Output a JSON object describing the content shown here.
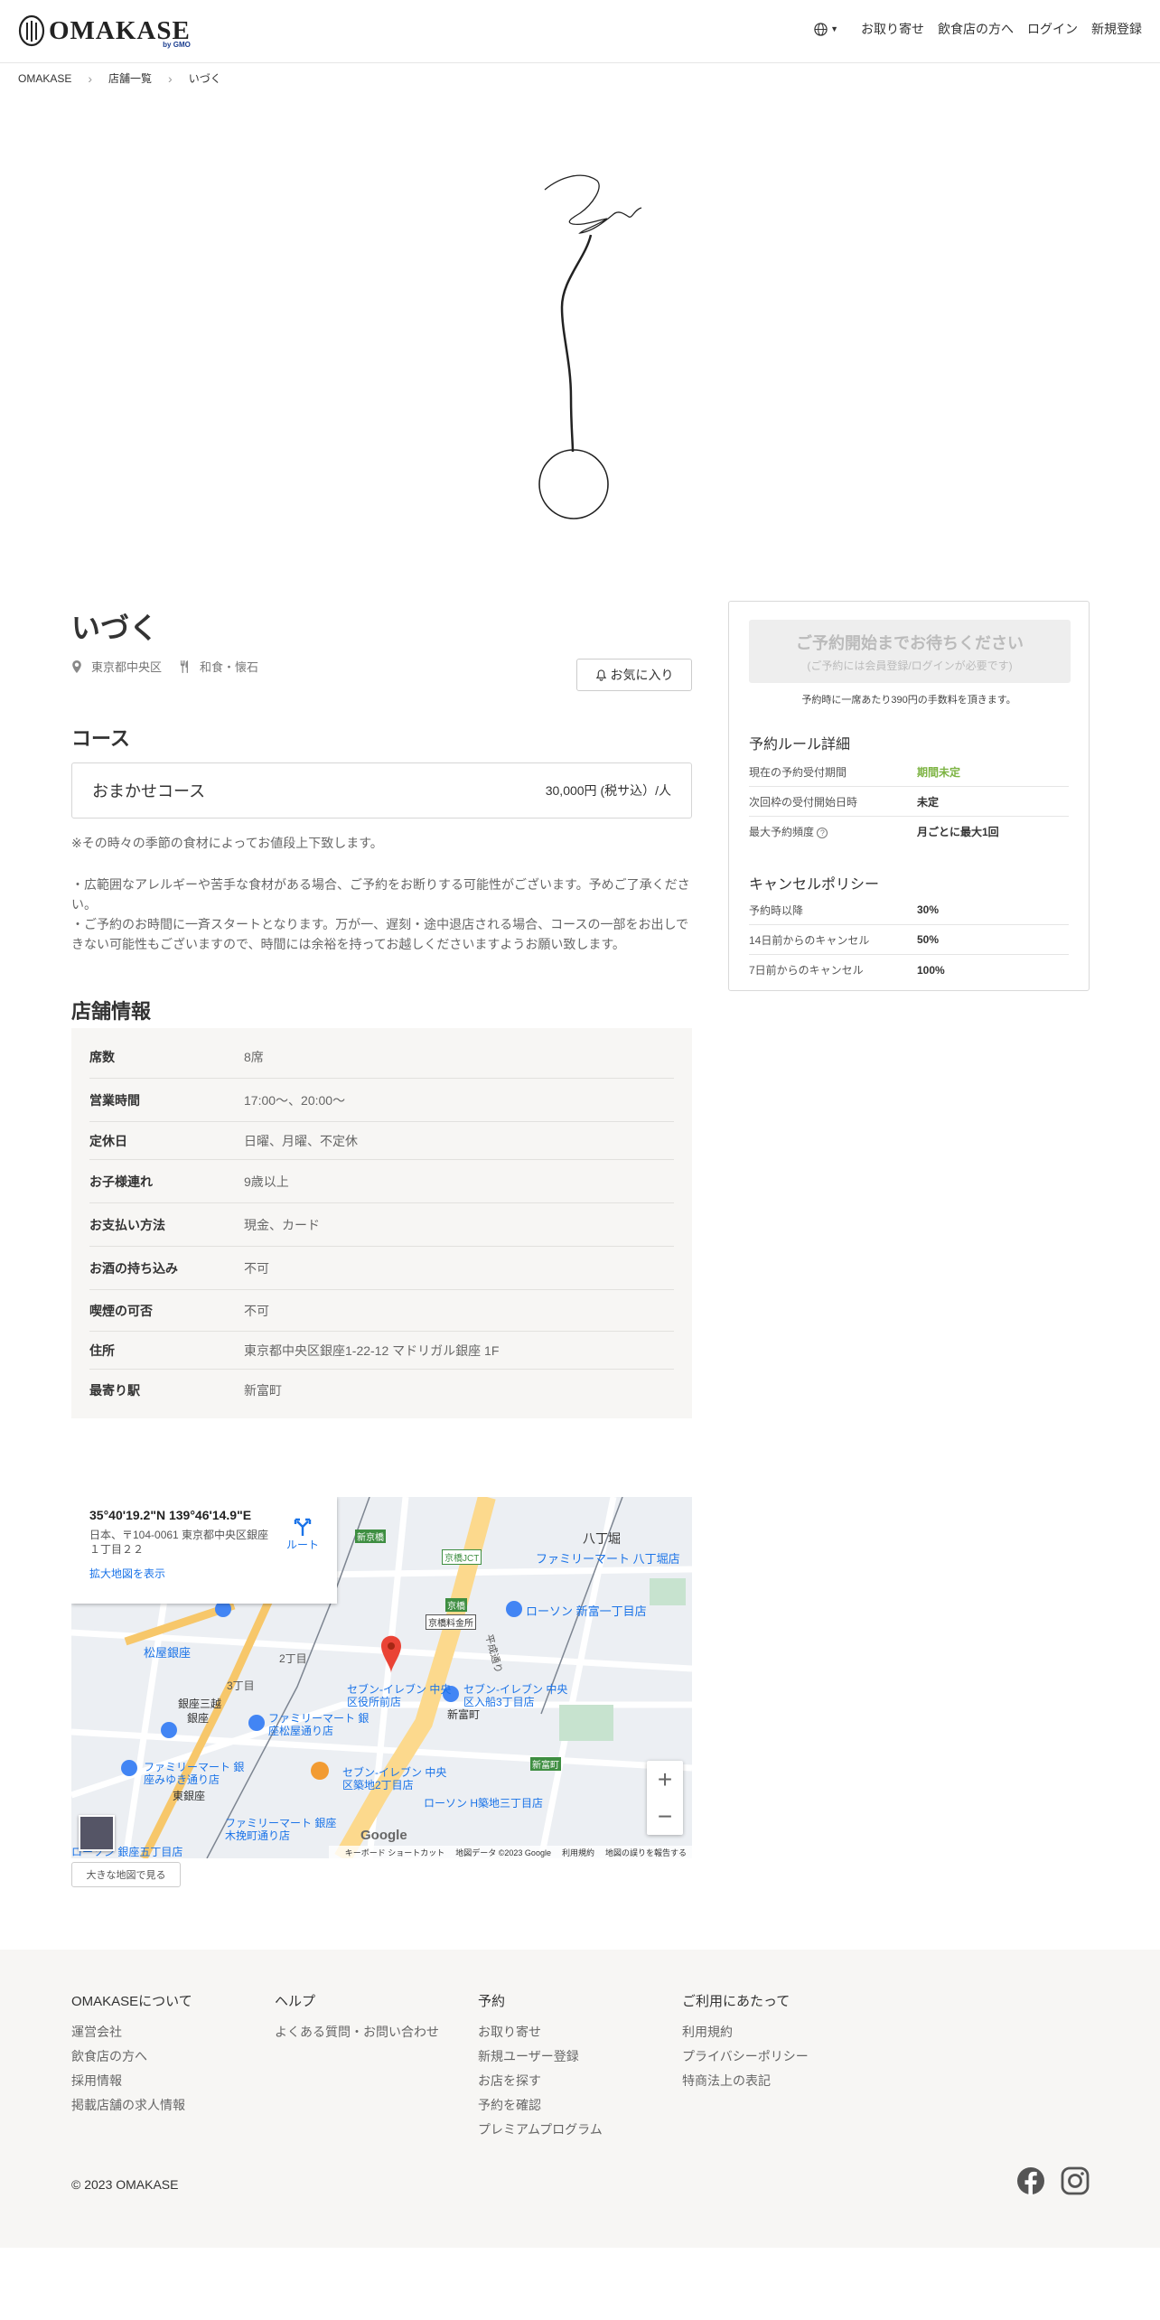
{
  "header": {
    "logo_text": "OMAKASE",
    "logo_sub": "by GMO",
    "nav": [
      "お取り寄せ",
      "飲食店の方へ",
      "ログイン",
      "新規登録"
    ]
  },
  "breadcrumb": [
    "OMAKASE",
    "店舗一覧",
    "いづく"
  ],
  "restaurant": {
    "name": "いづく",
    "area": "東京都中央区",
    "genre": "和食・懐石",
    "favorite_label": "お気に入り"
  },
  "course": {
    "heading": "コース",
    "name": "おまかせコース",
    "price": "30,000円 (税サ込）/人",
    "note1": "※その時々の季節の食材によってお値段上下致します。",
    "note2": "・広範囲なアレルギーや苦手な食材がある場合、ご予約をお断りする可能性がございます。予めご了承ください。\n・ご予約のお時間に一斉スタートとなります。万が一、遅刻・途中退店される場合、コースの一部をお出しできない可能性もございますので、時間には余裕を持ってお越しくださいますようお願い致します。"
  },
  "store_info": {
    "heading": "店舗情報",
    "rows": [
      {
        "label": "席数",
        "value": "8席"
      },
      {
        "label": "営業時間",
        "value": "17:00～、20:00～"
      },
      {
        "label": "定休日",
        "value": "日曜、月曜、不定休"
      },
      {
        "label": "お子様連れ",
        "value": "9歳以上"
      },
      {
        "label": "お支払い方法",
        "value": "現金、カード"
      },
      {
        "label": "お酒の持ち込み",
        "value": "不可"
      },
      {
        "label": "喫煙の可否",
        "value": "不可"
      },
      {
        "label": "住所",
        "value": "東京都中央区銀座1-22-12 マドリガル銀座 1F"
      },
      {
        "label": "最寄り駅",
        "value": "新富町"
      }
    ]
  },
  "map": {
    "coords": "35°40'19.2\"N 139°46'14.9\"E",
    "address": "日本、〒104-0061 東京都中央区銀座１丁目２２",
    "enlarge": "拡大地図を表示",
    "route": "ルート",
    "watermark": "Google",
    "footer": [
      "キーボード ショートカット",
      "地図データ ©2023 Google",
      "利用規約",
      "地図の誤りを報告する"
    ],
    "labels": [
      "八丁堀",
      "ファミリーマート 八丁堀店",
      "ローソン 新富一丁目店",
      "松屋銀座",
      "銀座三越",
      "銀座",
      "2丁目",
      "3丁目",
      "セブン-イレブン 中央区役所前店",
      "セブン-イレブン 中央区入船3丁目店",
      "新富町",
      "ファミリーマート 銀座松屋通り店",
      "セブン-イレブン 中央区築地2丁目店",
      "ローソン H築地三丁目店",
      "ファミリーマート 銀座みゆき通り店",
      "東銀座",
      "ファミリーマート 銀座木挽町通り店",
      "ローソン 銀座五丁目店",
      "京橋料金所",
      "新京橋",
      "京橋JCT",
      "京橋",
      "新富町",
      "平成通り"
    ],
    "large_map_button": "大きな地図で見る"
  },
  "sidebar": {
    "reserve_main": "ご予約開始までお待ちください",
    "reserve_sub": "(ご予約には会員登録/ログインが必要です)",
    "fee_note": "予約時に一席あたり390円の手数料を頂きます。",
    "rules_heading": "予約ルール詳細",
    "rules": [
      {
        "label": "現在の予約受付期間",
        "value": "期間未定",
        "highlight": true
      },
      {
        "label": "次回枠の受付開始日時",
        "value": "未定"
      },
      {
        "label": "最大予約頻度",
        "value": "月ごとに最大1回",
        "help": true
      }
    ],
    "cancel_heading": "キャンセルポリシー",
    "cancel": [
      {
        "label": "予約時以降",
        "value": "30%"
      },
      {
        "label": "14日前からのキャンセル",
        "value": "50%"
      },
      {
        "label": "7日前からのキャンセル",
        "value": "100%"
      }
    ]
  },
  "footer": {
    "columns": [
      {
        "heading": "OMAKASEについて",
        "links": [
          "運営会社",
          "飲食店の方へ",
          "採用情報",
          "掲載店舗の求人情報"
        ]
      },
      {
        "heading": "ヘルプ",
        "links": [
          "よくある質問・お問い合わせ"
        ]
      },
      {
        "heading": "予約",
        "links": [
          "お取り寄せ",
          "新規ユーザー登録",
          "お店を探す",
          "予約を確認",
          "プレミアムプログラム"
        ]
      },
      {
        "heading": "ご利用にあたって",
        "links": [
          "利用規約",
          "プライバシーポリシー",
          "特商法上の表記"
        ]
      }
    ],
    "copyright": "© 2023 OMAKASE"
  },
  "colors": {
    "highlight_green": "#7cb342",
    "link_blue": "#1a73e8",
    "footer_bg": "#f7f6f4",
    "marker_red": "#ea4335"
  }
}
